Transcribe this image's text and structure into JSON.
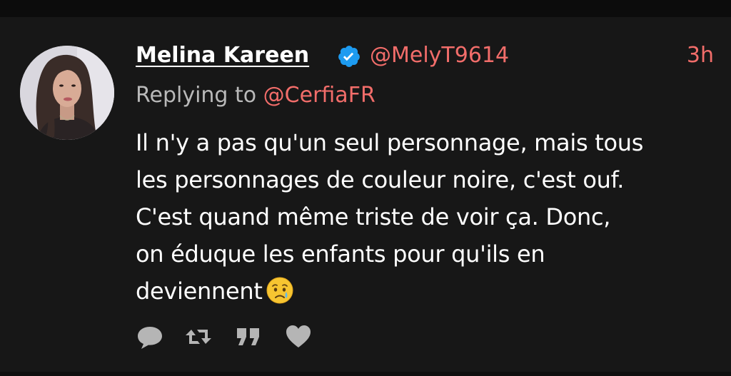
{
  "tweet": {
    "display_name": "Melina Kareen",
    "handle": "@MelyT9614",
    "timestamp": "3h",
    "reply_prefix": "Replying to ",
    "reply_target": "@CerfiaFR",
    "body_lines": [
      "Il n'y a pas qu'un seul personnage, mais tous",
      "les personnages de couleur noire, c'est ouf.",
      "C'est quand même triste de voir ça. Donc,",
      "on éduque les enfants pour qu'ils en",
      "deviennent"
    ],
    "emoji": "crying-face-emoji"
  },
  "icons": {
    "verified": "verified-badge-icon",
    "reply": "speech-bubble-icon",
    "retweet": "retweet-icon",
    "quote": "quote-icon",
    "like": "heart-icon"
  },
  "colors": {
    "background": "#171717",
    "accent": "#f26d6a",
    "verified": "#1d9bf0",
    "secondary_text": "#b9b9b9",
    "action_icon": "#b5b5b5"
  }
}
